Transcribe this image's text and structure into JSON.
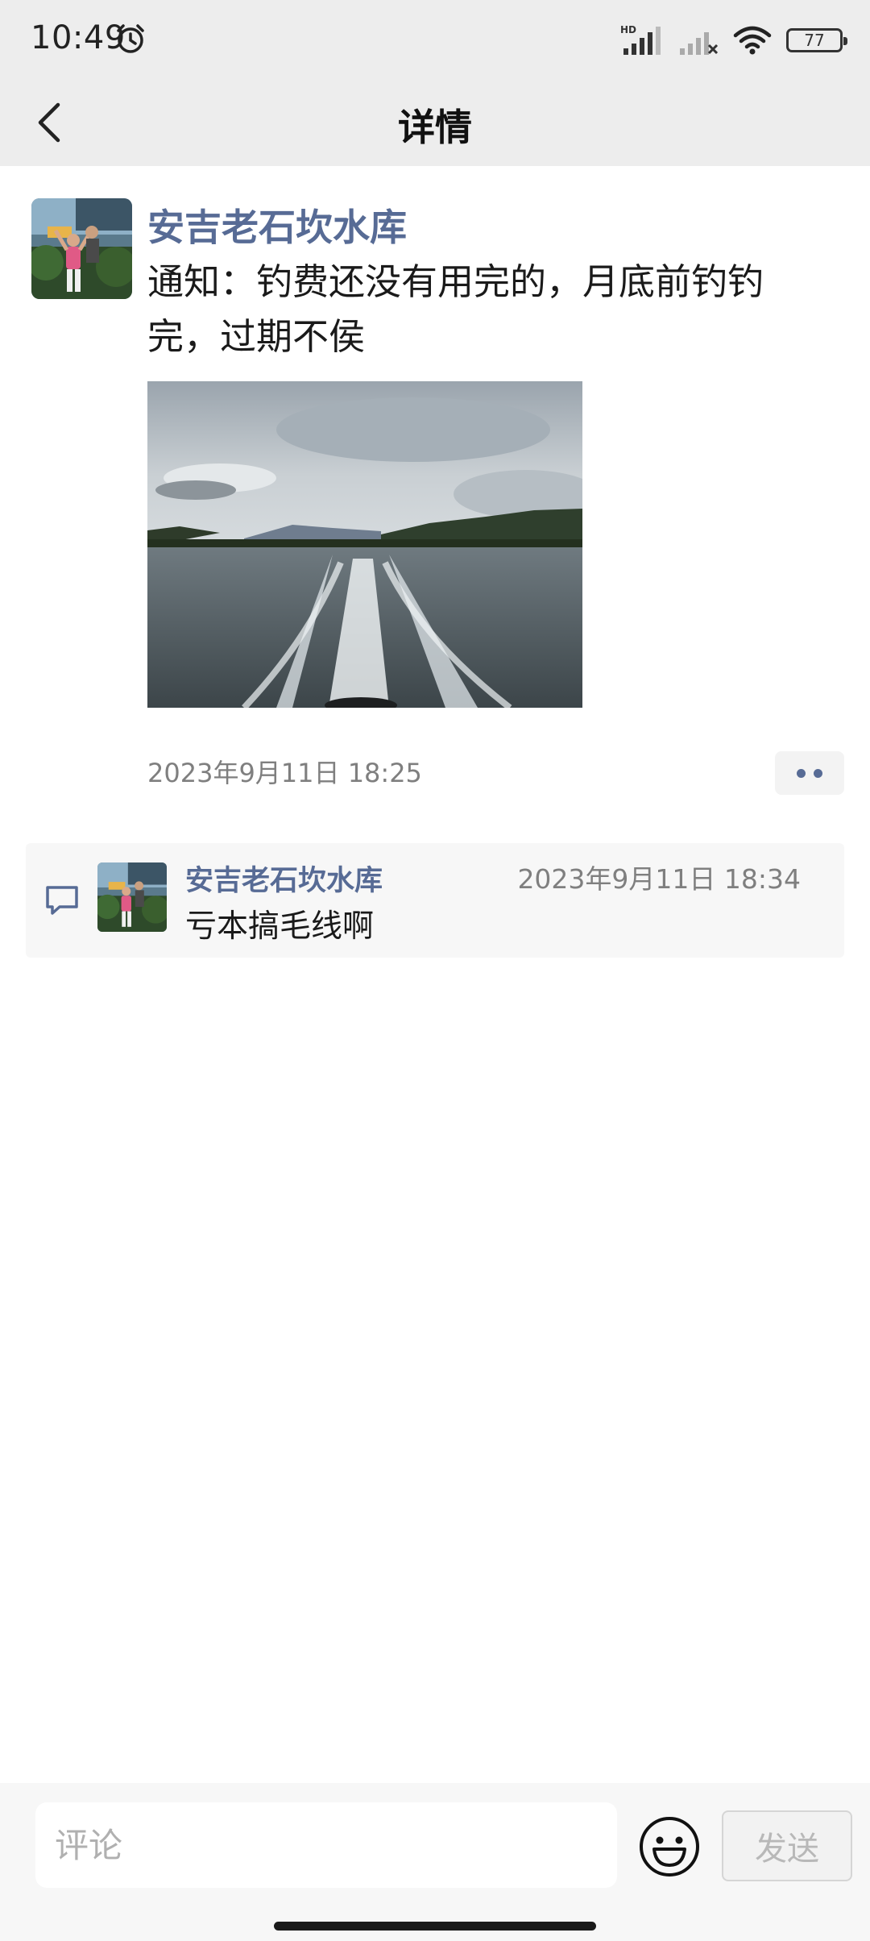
{
  "status_bar": {
    "time": "10:49",
    "battery": "77",
    "icons": [
      "alarm-icon",
      "hd-signal-icon",
      "no-signal-icon",
      "wifi-icon",
      "battery-icon"
    ]
  },
  "nav": {
    "title": "详情",
    "back_icon": "chevron-left-icon"
  },
  "post": {
    "author": "安吉老石坎水库",
    "text": "通知：钓费还没有用完的，月底前钓钓完，过期不侯",
    "image_alt": "boat-wake-on-lake-photo",
    "timestamp": "2023年9月11日 18:25"
  },
  "comments": [
    {
      "author": "安吉老石坎水库",
      "timestamp": "2023年9月11日 18:34",
      "text": "亏本搞毛线啊"
    }
  ],
  "composer": {
    "placeholder": "评论",
    "send_label": "发送",
    "emoji_icon": "smiley-face-icon"
  },
  "colors": {
    "link_blue": "#576b95",
    "header_bg": "#ededed",
    "comment_bg": "#f7f7f7"
  }
}
